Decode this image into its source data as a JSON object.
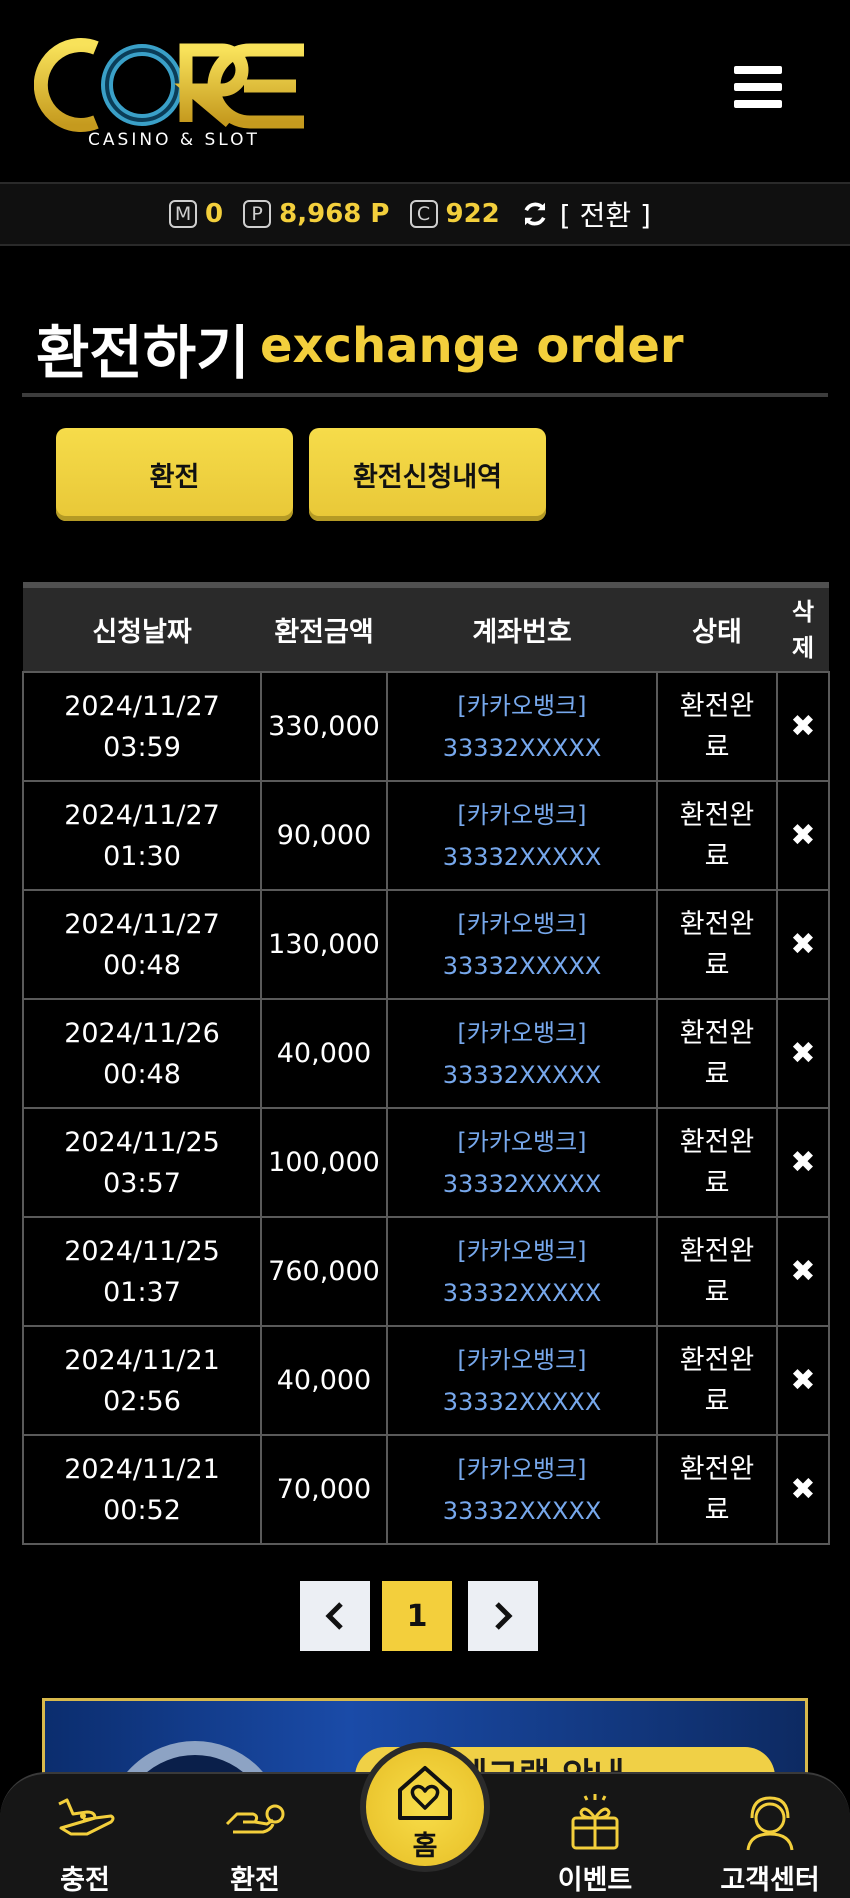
{
  "header": {
    "logo_text": "CORE",
    "logo_sub": "CASINO & SLOT"
  },
  "balance": {
    "m_badge": "M",
    "m_value": "0",
    "p_badge": "P",
    "p_value": "8,968 P",
    "c_badge": "C",
    "c_value": "922",
    "convert_label": "[ 전환 ]"
  },
  "page": {
    "title_ko": "환전하기",
    "title_en": "exchange order"
  },
  "tabs": {
    "exchange": "환전",
    "history": "환전신청내역"
  },
  "table": {
    "headers": [
      "신청날짜",
      "환전금액",
      "계좌번호",
      "상태",
      "삭제"
    ],
    "rows": [
      {
        "date": "2024/11/27",
        "time": "03:59",
        "amount": "330,000",
        "bank": "[카카오뱅크]",
        "account": "33332XXXXX",
        "status": "환전완료"
      },
      {
        "date": "2024/11/27",
        "time": "01:30",
        "amount": "90,000",
        "bank": "[카카오뱅크]",
        "account": "33332XXXXX",
        "status": "환전완료"
      },
      {
        "date": "2024/11/27",
        "time": "00:48",
        "amount": "130,000",
        "bank": "[카카오뱅크]",
        "account": "33332XXXXX",
        "status": "환전완료"
      },
      {
        "date": "2024/11/26",
        "time": "00:48",
        "amount": "40,000",
        "bank": "[카카오뱅크]",
        "account": "33332XXXXX",
        "status": "환전완료"
      },
      {
        "date": "2024/11/25",
        "time": "03:57",
        "amount": "100,000",
        "bank": "[카카오뱅크]",
        "account": "33332XXXXX",
        "status": "환전완료"
      },
      {
        "date": "2024/11/25",
        "time": "01:37",
        "amount": "760,000",
        "bank": "[카카오뱅크]",
        "account": "33332XXXXX",
        "status": "환전완료"
      },
      {
        "date": "2024/11/21",
        "time": "02:56",
        "amount": "40,000",
        "bank": "[카카오뱅크]",
        "account": "33332XXXXX",
        "status": "환전완료"
      },
      {
        "date": "2024/11/21",
        "time": "00:52",
        "amount": "70,000",
        "bank": "[카카오뱅크]",
        "account": "33332XXXXX",
        "status": "환전완료"
      }
    ]
  },
  "pagination": {
    "current": "1",
    "prev_icon": "chevron-left-icon",
    "next_icon": "chevron-right-icon"
  },
  "banner": {
    "text": "텔레그램 안내"
  },
  "bottom_nav": {
    "charge": "충전",
    "exchange": "환전",
    "home": "홈",
    "event": "이벤트",
    "support": "고객센터"
  },
  "colors": {
    "accent": "#f3cf3c",
    "bank_link": "#77a8ec",
    "background": "#000000"
  }
}
